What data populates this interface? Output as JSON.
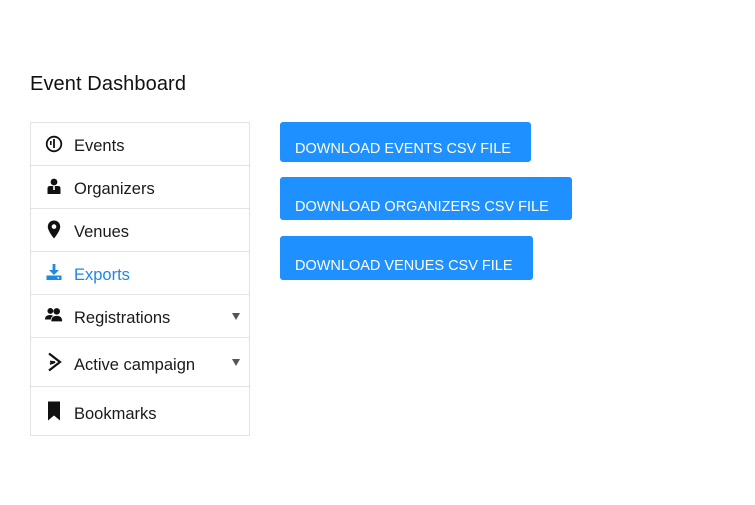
{
  "page": {
    "title": "Event Dashboard"
  },
  "sidebar": {
    "items": [
      {
        "label": "Events",
        "icon": "info-circle-icon"
      },
      {
        "label": "Organizers",
        "icon": "organizer-icon"
      },
      {
        "label": "Venues",
        "icon": "map-pin-icon"
      },
      {
        "label": "Exports",
        "icon": "download-icon",
        "active": true
      },
      {
        "label": "Registrations",
        "icon": "users-icon",
        "has_submenu": true
      },
      {
        "label": "Active campaign",
        "icon": "campaign-chevron-icon",
        "has_submenu": true
      },
      {
        "label": "Bookmarks",
        "icon": "bookmark-icon"
      }
    ],
    "active_color": "#1e88e5"
  },
  "main": {
    "buttons": [
      {
        "label": "DOWNLOAD EVENTS CSV FILE"
      },
      {
        "label": "DOWNLOAD ORGANIZERS CSV FILE"
      },
      {
        "label": "DOWNLOAD VENUES CSV FILE"
      }
    ],
    "button_color": "#1e90ff"
  }
}
